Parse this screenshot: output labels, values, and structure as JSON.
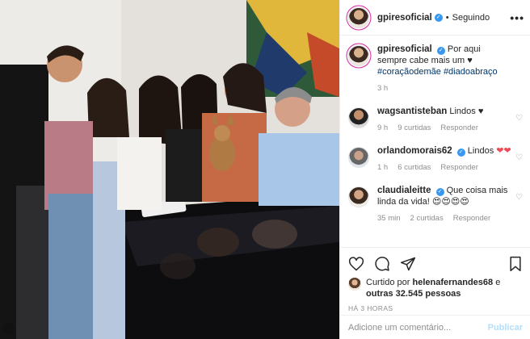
{
  "post": {
    "username": "gpiresoficial",
    "follow_status": "Seguindo",
    "more_label": "•••"
  },
  "caption": {
    "username": "gpiresoficial",
    "text": "Por aqui sempre cabe mais um ♥",
    "tags": "#coraçãodemãe #diadoabraço",
    "age": "3 h"
  },
  "comments": [
    {
      "username": "wagsantisteban",
      "text": "Lindos ♥",
      "age": "9 h",
      "likes": "9 curtidas",
      "reply": "Responder"
    },
    {
      "username": "orlandomorais62",
      "text": "Lindos",
      "emoji": "❤❤",
      "age": "1 h",
      "likes": "6 curtidas",
      "reply": "Responder"
    },
    {
      "username": "claudialeitte",
      "text": "Que coisa mais linda da vida!",
      "emoji": "😍😍😍😍",
      "age": "35 min",
      "likes": "2 curtidas",
      "reply": "Responder"
    }
  ],
  "likes": {
    "prefix": "Curtido por",
    "user": "helenafernandes68",
    "joiner": "e",
    "others": "outras 32.545 pessoas"
  },
  "timestamp": "HÁ 3 HORAS",
  "comment_input": {
    "placeholder": "Adicione um comentário...",
    "publish_label": "Publicar"
  },
  "colors": {
    "link": "#003569",
    "verified": "#3897f0",
    "muted": "#8e8e8e",
    "heart": "#ed4956",
    "publish": "#b2dffc"
  },
  "icons": [
    "more-icon",
    "heart-icon",
    "comment-icon",
    "share-icon",
    "bookmark-icon",
    "verified-icon"
  ]
}
